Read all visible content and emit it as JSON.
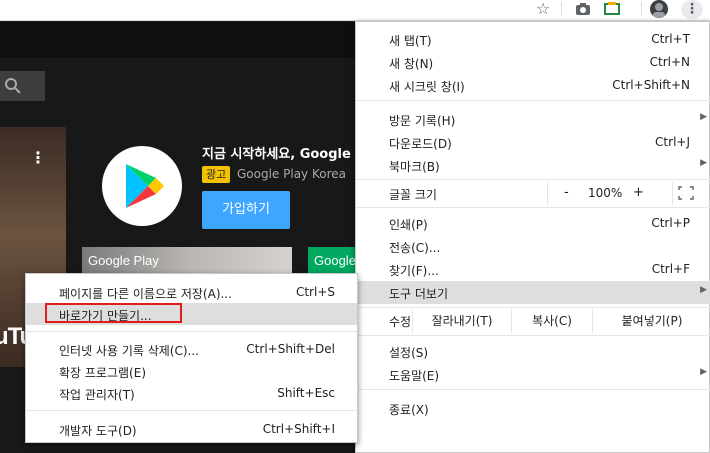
{
  "menu": {
    "new_tab": {
      "label": "새 탭(T)",
      "shortcut": "Ctrl+T"
    },
    "new_window": {
      "label": "새 창(N)",
      "shortcut": "Ctrl+N"
    },
    "incognito": {
      "label": "새 시크릿 창(I)",
      "shortcut": "Ctrl+Shift+N"
    },
    "history": {
      "label": "방문 기록(H)"
    },
    "downloads": {
      "label": "다운로드(D)",
      "shortcut": "Ctrl+J"
    },
    "bookmarks": {
      "label": "북마크(B)"
    },
    "zoom": {
      "label": "글꼴 크기",
      "minus": "-",
      "value": "100%",
      "plus": "+"
    },
    "print": {
      "label": "인쇄(P)",
      "shortcut": "Ctrl+P"
    },
    "cast": {
      "label": "전송(C)..."
    },
    "find": {
      "label": "찾기(F)...",
      "shortcut": "Ctrl+F"
    },
    "more_tools": {
      "label": "도구 더보기"
    },
    "edit": {
      "label": "수정",
      "cut": "잘라내기(T)",
      "copy": "복사(C)",
      "paste": "붙여넣기(P)"
    },
    "settings": {
      "label": "설정(S)"
    },
    "help": {
      "label": "도움말(E)"
    },
    "exit": {
      "label": "종료(X)"
    }
  },
  "submenu": {
    "save_page_as": {
      "label": "페이지를 다른 이름으로 저장(A)...",
      "shortcut": "Ctrl+S"
    },
    "create_shortcut": {
      "label": "바로가기 만들기..."
    },
    "clear_browsing": {
      "label": "인터넷 사용 기록 삭제(C)...",
      "shortcut": "Ctrl+Shift+Del"
    },
    "extensions": {
      "label": "확장 프로그램(E)"
    },
    "task_manager": {
      "label": "작업 관리자(T)",
      "shortcut": "Shift+Esc"
    },
    "developer_tools": {
      "label": "개발자 도구(D)",
      "shortcut": "Ctrl+Shift+I"
    }
  },
  "page": {
    "ad_title": "지금 시작하세요, Google",
    "ad_badge": "광고",
    "ad_channel": "Google Play Korea",
    "ad_button": "가입하기",
    "banner1": "Google Play",
    "banner2": "Google",
    "thumb_text": "uTu"
  },
  "colors": {
    "highlight": "#dedede",
    "callout_red": "#e21b1b",
    "youtube_blue": "#3ea6ff",
    "ad_badge_yellow": "#f2c200"
  }
}
